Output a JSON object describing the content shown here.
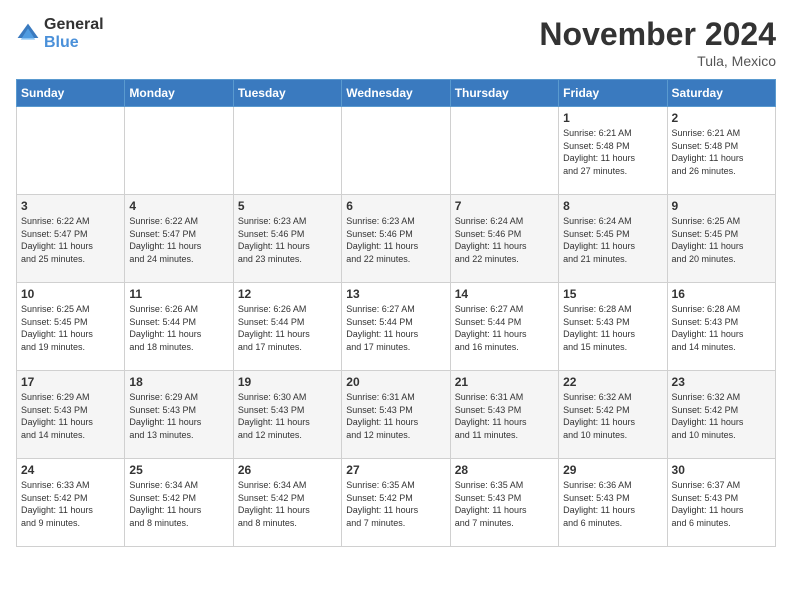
{
  "logo": {
    "text_general": "General",
    "text_blue": "Blue"
  },
  "header": {
    "month": "November 2024",
    "location": "Tula, Mexico"
  },
  "weekdays": [
    "Sunday",
    "Monday",
    "Tuesday",
    "Wednesday",
    "Thursday",
    "Friday",
    "Saturday"
  ],
  "weeks": [
    [
      {
        "day": "",
        "info": ""
      },
      {
        "day": "",
        "info": ""
      },
      {
        "day": "",
        "info": ""
      },
      {
        "day": "",
        "info": ""
      },
      {
        "day": "",
        "info": ""
      },
      {
        "day": "1",
        "info": "Sunrise: 6:21 AM\nSunset: 5:48 PM\nDaylight: 11 hours\nand 27 minutes."
      },
      {
        "day": "2",
        "info": "Sunrise: 6:21 AM\nSunset: 5:48 PM\nDaylight: 11 hours\nand 26 minutes."
      }
    ],
    [
      {
        "day": "3",
        "info": "Sunrise: 6:22 AM\nSunset: 5:47 PM\nDaylight: 11 hours\nand 25 minutes."
      },
      {
        "day": "4",
        "info": "Sunrise: 6:22 AM\nSunset: 5:47 PM\nDaylight: 11 hours\nand 24 minutes."
      },
      {
        "day": "5",
        "info": "Sunrise: 6:23 AM\nSunset: 5:46 PM\nDaylight: 11 hours\nand 23 minutes."
      },
      {
        "day": "6",
        "info": "Sunrise: 6:23 AM\nSunset: 5:46 PM\nDaylight: 11 hours\nand 22 minutes."
      },
      {
        "day": "7",
        "info": "Sunrise: 6:24 AM\nSunset: 5:46 PM\nDaylight: 11 hours\nand 22 minutes."
      },
      {
        "day": "8",
        "info": "Sunrise: 6:24 AM\nSunset: 5:45 PM\nDaylight: 11 hours\nand 21 minutes."
      },
      {
        "day": "9",
        "info": "Sunrise: 6:25 AM\nSunset: 5:45 PM\nDaylight: 11 hours\nand 20 minutes."
      }
    ],
    [
      {
        "day": "10",
        "info": "Sunrise: 6:25 AM\nSunset: 5:45 PM\nDaylight: 11 hours\nand 19 minutes."
      },
      {
        "day": "11",
        "info": "Sunrise: 6:26 AM\nSunset: 5:44 PM\nDaylight: 11 hours\nand 18 minutes."
      },
      {
        "day": "12",
        "info": "Sunrise: 6:26 AM\nSunset: 5:44 PM\nDaylight: 11 hours\nand 17 minutes."
      },
      {
        "day": "13",
        "info": "Sunrise: 6:27 AM\nSunset: 5:44 PM\nDaylight: 11 hours\nand 17 minutes."
      },
      {
        "day": "14",
        "info": "Sunrise: 6:27 AM\nSunset: 5:44 PM\nDaylight: 11 hours\nand 16 minutes."
      },
      {
        "day": "15",
        "info": "Sunrise: 6:28 AM\nSunset: 5:43 PM\nDaylight: 11 hours\nand 15 minutes."
      },
      {
        "day": "16",
        "info": "Sunrise: 6:28 AM\nSunset: 5:43 PM\nDaylight: 11 hours\nand 14 minutes."
      }
    ],
    [
      {
        "day": "17",
        "info": "Sunrise: 6:29 AM\nSunset: 5:43 PM\nDaylight: 11 hours\nand 14 minutes."
      },
      {
        "day": "18",
        "info": "Sunrise: 6:29 AM\nSunset: 5:43 PM\nDaylight: 11 hours\nand 13 minutes."
      },
      {
        "day": "19",
        "info": "Sunrise: 6:30 AM\nSunset: 5:43 PM\nDaylight: 11 hours\nand 12 minutes."
      },
      {
        "day": "20",
        "info": "Sunrise: 6:31 AM\nSunset: 5:43 PM\nDaylight: 11 hours\nand 12 minutes."
      },
      {
        "day": "21",
        "info": "Sunrise: 6:31 AM\nSunset: 5:43 PM\nDaylight: 11 hours\nand 11 minutes."
      },
      {
        "day": "22",
        "info": "Sunrise: 6:32 AM\nSunset: 5:42 PM\nDaylight: 11 hours\nand 10 minutes."
      },
      {
        "day": "23",
        "info": "Sunrise: 6:32 AM\nSunset: 5:42 PM\nDaylight: 11 hours\nand 10 minutes."
      }
    ],
    [
      {
        "day": "24",
        "info": "Sunrise: 6:33 AM\nSunset: 5:42 PM\nDaylight: 11 hours\nand 9 minutes."
      },
      {
        "day": "25",
        "info": "Sunrise: 6:34 AM\nSunset: 5:42 PM\nDaylight: 11 hours\nand 8 minutes."
      },
      {
        "day": "26",
        "info": "Sunrise: 6:34 AM\nSunset: 5:42 PM\nDaylight: 11 hours\nand 8 minutes."
      },
      {
        "day": "27",
        "info": "Sunrise: 6:35 AM\nSunset: 5:42 PM\nDaylight: 11 hours\nand 7 minutes."
      },
      {
        "day": "28",
        "info": "Sunrise: 6:35 AM\nSunset: 5:43 PM\nDaylight: 11 hours\nand 7 minutes."
      },
      {
        "day": "29",
        "info": "Sunrise: 6:36 AM\nSunset: 5:43 PM\nDaylight: 11 hours\nand 6 minutes."
      },
      {
        "day": "30",
        "info": "Sunrise: 6:37 AM\nSunset: 5:43 PM\nDaylight: 11 hours\nand 6 minutes."
      }
    ]
  ]
}
